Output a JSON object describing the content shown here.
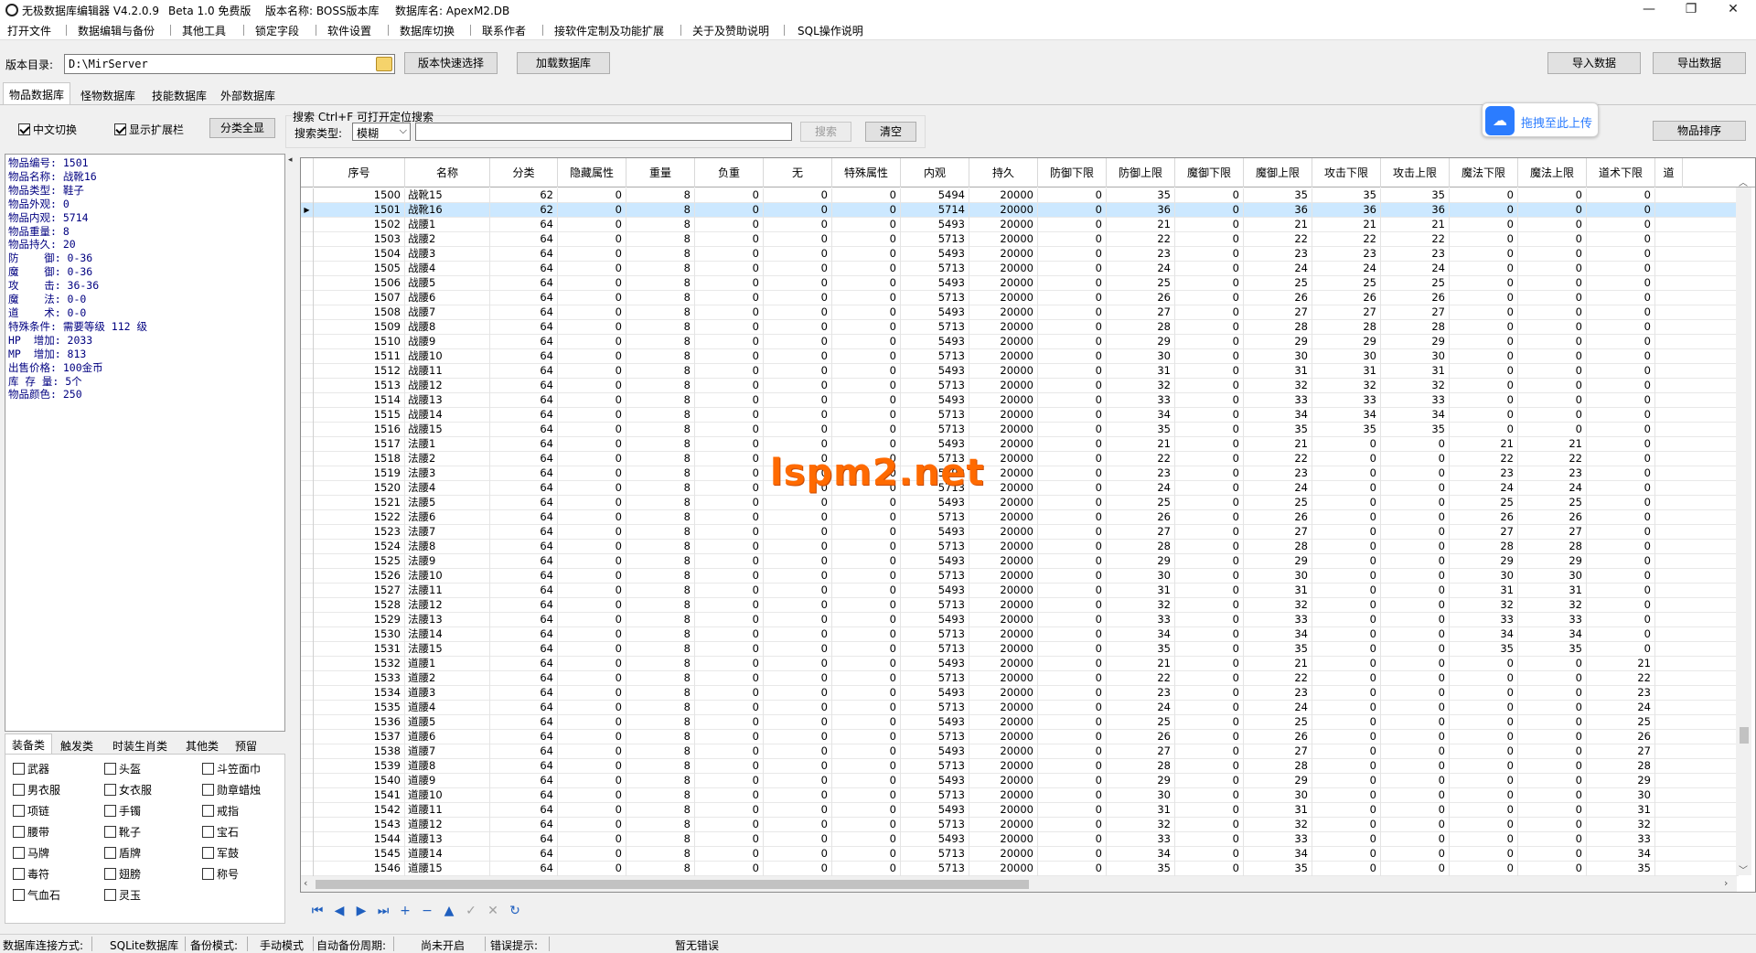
{
  "window": {
    "title": "无极数据库编辑器 V4.2.0.9",
    "beta": "Beta 1.0 免费版",
    "version_label": "版本名称: BOSS版本库",
    "db_label": "数据库名: ApexM2.DB",
    "minimize": "—",
    "maximize": "❐",
    "close": "✕"
  },
  "menu": [
    "打开文件",
    "数据编辑与备份",
    "其他工具",
    "锁定字段",
    "软件设置",
    "数据库切换",
    "联系作者",
    "接软件定制及功能扩展",
    "关于及赞助说明",
    "SQL操作说明"
  ],
  "toolbar": {
    "dir_label": "版本目录:",
    "dir_value": "D:\\MirServer",
    "quick_select": "版本快速选择",
    "load_db": "加载数据库",
    "import": "导入数据",
    "export": "导出数据"
  },
  "tabs": [
    "物品数据库",
    "怪物数据库",
    "技能数据库",
    "外部数据库"
  ],
  "options": {
    "chinese_switch": "中文切换",
    "show_ext": "显示扩展栏",
    "show_all": "分类全显",
    "search_hint": "搜索  Ctrl+F 可打开定位搜索",
    "search_type_label": "搜索类型:",
    "search_type_value": "模糊",
    "search_btn": "搜索",
    "clear_btn": "清空",
    "upload": "拖拽至此上传",
    "sort": "物品排序"
  },
  "info": [
    "物品编号: 1501",
    "物品名称: 战靴16",
    "物品类型: 鞋子",
    "物品外观: 0",
    "物品内观: 5714",
    "物品重量: 8",
    "物品持久: 20",
    "防    御: 0-36",
    "魔    御: 0-36",
    "攻    击: 36-36",
    "魔    法: 0-0",
    "道    术: 0-0",
    "特殊条件: 需要等级 112 级",
    "HP  增加: 2033",
    "MP  增加: 813",
    "出售价格: 100金币",
    "库 存 量: 5个",
    "物品颜色: 250"
  ],
  "cat_tabs": [
    "装备类",
    "触发类",
    "时装生肖类",
    "其他类",
    "预留"
  ],
  "categories": [
    {
      "label": "武器",
      "checked": false
    },
    {
      "label": "头盔",
      "checked": false
    },
    {
      "label": "斗笠面巾",
      "checked": false
    },
    {
      "label": "男衣服",
      "checked": false
    },
    {
      "label": "女衣服",
      "checked": false
    },
    {
      "label": "勋章蜡烛",
      "checked": false
    },
    {
      "label": "项链",
      "checked": false
    },
    {
      "label": "手镯",
      "checked": false
    },
    {
      "label": "戒指",
      "checked": false
    },
    {
      "label": "腰带",
      "checked": false
    },
    {
      "label": "靴子",
      "checked": false
    },
    {
      "label": "宝石",
      "checked": false
    },
    {
      "label": "马牌",
      "checked": false
    },
    {
      "label": "盾牌",
      "checked": false
    },
    {
      "label": "军鼓",
      "checked": false
    },
    {
      "label": "毒符",
      "checked": false
    },
    {
      "label": "翅膀",
      "checked": false
    },
    {
      "label": "称号",
      "checked": false
    },
    {
      "label": "气血石",
      "checked": false
    },
    {
      "label": "灵玉",
      "checked": false
    }
  ],
  "grid": {
    "columns": [
      "序号",
      "名称",
      "分类",
      "隐藏属性",
      "重量",
      "负重",
      "无",
      "特殊属性",
      "内观",
      "持久",
      "防御下限",
      "防御上限",
      "魔御下限",
      "魔御上限",
      "攻击下限",
      "攻击上限",
      "魔法下限",
      "魔法上限",
      "道术下限",
      "道"
    ],
    "selected_index": 1,
    "rows": [
      [
        "1500",
        "战靴15",
        "62",
        "0",
        "8",
        "0",
        "0",
        "0",
        "5494",
        "20000",
        "0",
        "35",
        "0",
        "35",
        "35",
        "35",
        "0",
        "0",
        "0"
      ],
      [
        "1501",
        "战靴16",
        "62",
        "0",
        "8",
        "0",
        "0",
        "0",
        "5714",
        "20000",
        "0",
        "36",
        "0",
        "36",
        "36",
        "36",
        "0",
        "0",
        "0"
      ],
      [
        "1502",
        "战腰1",
        "64",
        "0",
        "8",
        "0",
        "0",
        "0",
        "5493",
        "20000",
        "0",
        "21",
        "0",
        "21",
        "21",
        "21",
        "0",
        "0",
        "0"
      ],
      [
        "1503",
        "战腰2",
        "64",
        "0",
        "8",
        "0",
        "0",
        "0",
        "5713",
        "20000",
        "0",
        "22",
        "0",
        "22",
        "22",
        "22",
        "0",
        "0",
        "0"
      ],
      [
        "1504",
        "战腰3",
        "64",
        "0",
        "8",
        "0",
        "0",
        "0",
        "5493",
        "20000",
        "0",
        "23",
        "0",
        "23",
        "23",
        "23",
        "0",
        "0",
        "0"
      ],
      [
        "1505",
        "战腰4",
        "64",
        "0",
        "8",
        "0",
        "0",
        "0",
        "5713",
        "20000",
        "0",
        "24",
        "0",
        "24",
        "24",
        "24",
        "0",
        "0",
        "0"
      ],
      [
        "1506",
        "战腰5",
        "64",
        "0",
        "8",
        "0",
        "0",
        "0",
        "5493",
        "20000",
        "0",
        "25",
        "0",
        "25",
        "25",
        "25",
        "0",
        "0",
        "0"
      ],
      [
        "1507",
        "战腰6",
        "64",
        "0",
        "8",
        "0",
        "0",
        "0",
        "5713",
        "20000",
        "0",
        "26",
        "0",
        "26",
        "26",
        "26",
        "0",
        "0",
        "0"
      ],
      [
        "1508",
        "战腰7",
        "64",
        "0",
        "8",
        "0",
        "0",
        "0",
        "5493",
        "20000",
        "0",
        "27",
        "0",
        "27",
        "27",
        "27",
        "0",
        "0",
        "0"
      ],
      [
        "1509",
        "战腰8",
        "64",
        "0",
        "8",
        "0",
        "0",
        "0",
        "5713",
        "20000",
        "0",
        "28",
        "0",
        "28",
        "28",
        "28",
        "0",
        "0",
        "0"
      ],
      [
        "1510",
        "战腰9",
        "64",
        "0",
        "8",
        "0",
        "0",
        "0",
        "5493",
        "20000",
        "0",
        "29",
        "0",
        "29",
        "29",
        "29",
        "0",
        "0",
        "0"
      ],
      [
        "1511",
        "战腰10",
        "64",
        "0",
        "8",
        "0",
        "0",
        "0",
        "5713",
        "20000",
        "0",
        "30",
        "0",
        "30",
        "30",
        "30",
        "0",
        "0",
        "0"
      ],
      [
        "1512",
        "战腰11",
        "64",
        "0",
        "8",
        "0",
        "0",
        "0",
        "5493",
        "20000",
        "0",
        "31",
        "0",
        "31",
        "31",
        "31",
        "0",
        "0",
        "0"
      ],
      [
        "1513",
        "战腰12",
        "64",
        "0",
        "8",
        "0",
        "0",
        "0",
        "5713",
        "20000",
        "0",
        "32",
        "0",
        "32",
        "32",
        "32",
        "0",
        "0",
        "0"
      ],
      [
        "1514",
        "战腰13",
        "64",
        "0",
        "8",
        "0",
        "0",
        "0",
        "5493",
        "20000",
        "0",
        "33",
        "0",
        "33",
        "33",
        "33",
        "0",
        "0",
        "0"
      ],
      [
        "1515",
        "战腰14",
        "64",
        "0",
        "8",
        "0",
        "0",
        "0",
        "5713",
        "20000",
        "0",
        "34",
        "0",
        "34",
        "34",
        "34",
        "0",
        "0",
        "0"
      ],
      [
        "1516",
        "战腰15",
        "64",
        "0",
        "8",
        "0",
        "0",
        "0",
        "5713",
        "20000",
        "0",
        "35",
        "0",
        "35",
        "35",
        "35",
        "0",
        "0",
        "0"
      ],
      [
        "1517",
        "法腰1",
        "64",
        "0",
        "8",
        "0",
        "0",
        "0",
        "5493",
        "20000",
        "0",
        "21",
        "0",
        "21",
        "0",
        "0",
        "21",
        "21",
        "0"
      ],
      [
        "1518",
        "法腰2",
        "64",
        "0",
        "8",
        "0",
        "0",
        "0",
        "5713",
        "20000",
        "0",
        "22",
        "0",
        "22",
        "0",
        "0",
        "22",
        "22",
        "0"
      ],
      [
        "1519",
        "法腰3",
        "64",
        "0",
        "8",
        "0",
        "0",
        "0",
        "5493",
        "20000",
        "0",
        "23",
        "0",
        "23",
        "0",
        "0",
        "23",
        "23",
        "0"
      ],
      [
        "1520",
        "法腰4",
        "64",
        "0",
        "8",
        "0",
        "0",
        "0",
        "5713",
        "20000",
        "0",
        "24",
        "0",
        "24",
        "0",
        "0",
        "24",
        "24",
        "0"
      ],
      [
        "1521",
        "法腰5",
        "64",
        "0",
        "8",
        "0",
        "0",
        "0",
        "5493",
        "20000",
        "0",
        "25",
        "0",
        "25",
        "0",
        "0",
        "25",
        "25",
        "0"
      ],
      [
        "1522",
        "法腰6",
        "64",
        "0",
        "8",
        "0",
        "0",
        "0",
        "5713",
        "20000",
        "0",
        "26",
        "0",
        "26",
        "0",
        "0",
        "26",
        "26",
        "0"
      ],
      [
        "1523",
        "法腰7",
        "64",
        "0",
        "8",
        "0",
        "0",
        "0",
        "5493",
        "20000",
        "0",
        "27",
        "0",
        "27",
        "0",
        "0",
        "27",
        "27",
        "0"
      ],
      [
        "1524",
        "法腰8",
        "64",
        "0",
        "8",
        "0",
        "0",
        "0",
        "5713",
        "20000",
        "0",
        "28",
        "0",
        "28",
        "0",
        "0",
        "28",
        "28",
        "0"
      ],
      [
        "1525",
        "法腰9",
        "64",
        "0",
        "8",
        "0",
        "0",
        "0",
        "5493",
        "20000",
        "0",
        "29",
        "0",
        "29",
        "0",
        "0",
        "29",
        "29",
        "0"
      ],
      [
        "1526",
        "法腰10",
        "64",
        "0",
        "8",
        "0",
        "0",
        "0",
        "5713",
        "20000",
        "0",
        "30",
        "0",
        "30",
        "0",
        "0",
        "30",
        "30",
        "0"
      ],
      [
        "1527",
        "法腰11",
        "64",
        "0",
        "8",
        "0",
        "0",
        "0",
        "5493",
        "20000",
        "0",
        "31",
        "0",
        "31",
        "0",
        "0",
        "31",
        "31",
        "0"
      ],
      [
        "1528",
        "法腰12",
        "64",
        "0",
        "8",
        "0",
        "0",
        "0",
        "5713",
        "20000",
        "0",
        "32",
        "0",
        "32",
        "0",
        "0",
        "32",
        "32",
        "0"
      ],
      [
        "1529",
        "法腰13",
        "64",
        "0",
        "8",
        "0",
        "0",
        "0",
        "5493",
        "20000",
        "0",
        "33",
        "0",
        "33",
        "0",
        "0",
        "33",
        "33",
        "0"
      ],
      [
        "1530",
        "法腰14",
        "64",
        "0",
        "8",
        "0",
        "0",
        "0",
        "5713",
        "20000",
        "0",
        "34",
        "0",
        "34",
        "0",
        "0",
        "34",
        "34",
        "0"
      ],
      [
        "1531",
        "法腰15",
        "64",
        "0",
        "8",
        "0",
        "0",
        "0",
        "5713",
        "20000",
        "0",
        "35",
        "0",
        "35",
        "0",
        "0",
        "35",
        "35",
        "0"
      ],
      [
        "1532",
        "道腰1",
        "64",
        "0",
        "8",
        "0",
        "0",
        "0",
        "5493",
        "20000",
        "0",
        "21",
        "0",
        "21",
        "0",
        "0",
        "0",
        "0",
        "21"
      ],
      [
        "1533",
        "道腰2",
        "64",
        "0",
        "8",
        "0",
        "0",
        "0",
        "5713",
        "20000",
        "0",
        "22",
        "0",
        "22",
        "0",
        "0",
        "0",
        "0",
        "22"
      ],
      [
        "1534",
        "道腰3",
        "64",
        "0",
        "8",
        "0",
        "0",
        "0",
        "5493",
        "20000",
        "0",
        "23",
        "0",
        "23",
        "0",
        "0",
        "0",
        "0",
        "23"
      ],
      [
        "1535",
        "道腰4",
        "64",
        "0",
        "8",
        "0",
        "0",
        "0",
        "5713",
        "20000",
        "0",
        "24",
        "0",
        "24",
        "0",
        "0",
        "0",
        "0",
        "24"
      ],
      [
        "1536",
        "道腰5",
        "64",
        "0",
        "8",
        "0",
        "0",
        "0",
        "5493",
        "20000",
        "0",
        "25",
        "0",
        "25",
        "0",
        "0",
        "0",
        "0",
        "25"
      ],
      [
        "1537",
        "道腰6",
        "64",
        "0",
        "8",
        "0",
        "0",
        "0",
        "5713",
        "20000",
        "0",
        "26",
        "0",
        "26",
        "0",
        "0",
        "0",
        "0",
        "26"
      ],
      [
        "1538",
        "道腰7",
        "64",
        "0",
        "8",
        "0",
        "0",
        "0",
        "5493",
        "20000",
        "0",
        "27",
        "0",
        "27",
        "0",
        "0",
        "0",
        "0",
        "27"
      ],
      [
        "1539",
        "道腰8",
        "64",
        "0",
        "8",
        "0",
        "0",
        "0",
        "5713",
        "20000",
        "0",
        "28",
        "0",
        "28",
        "0",
        "0",
        "0",
        "0",
        "28"
      ],
      [
        "1540",
        "道腰9",
        "64",
        "0",
        "8",
        "0",
        "0",
        "0",
        "5493",
        "20000",
        "0",
        "29",
        "0",
        "29",
        "0",
        "0",
        "0",
        "0",
        "29"
      ],
      [
        "1541",
        "道腰10",
        "64",
        "0",
        "8",
        "0",
        "0",
        "0",
        "5713",
        "20000",
        "0",
        "30",
        "0",
        "30",
        "0",
        "0",
        "0",
        "0",
        "30"
      ],
      [
        "1542",
        "道腰11",
        "64",
        "0",
        "8",
        "0",
        "0",
        "0",
        "5493",
        "20000",
        "0",
        "31",
        "0",
        "31",
        "0",
        "0",
        "0",
        "0",
        "31"
      ],
      [
        "1543",
        "道腰12",
        "64",
        "0",
        "8",
        "0",
        "0",
        "0",
        "5713",
        "20000",
        "0",
        "32",
        "0",
        "32",
        "0",
        "0",
        "0",
        "0",
        "32"
      ],
      [
        "1544",
        "道腰13",
        "64",
        "0",
        "8",
        "0",
        "0",
        "0",
        "5493",
        "20000",
        "0",
        "33",
        "0",
        "33",
        "0",
        "0",
        "0",
        "0",
        "33"
      ],
      [
        "1545",
        "道腰14",
        "64",
        "0",
        "8",
        "0",
        "0",
        "0",
        "5713",
        "20000",
        "0",
        "34",
        "0",
        "34",
        "0",
        "0",
        "0",
        "0",
        "34"
      ],
      [
        "1546",
        "道腰15",
        "64",
        "0",
        "8",
        "0",
        "0",
        "0",
        "5713",
        "20000",
        "0",
        "35",
        "0",
        "35",
        "0",
        "0",
        "0",
        "0",
        "35"
      ]
    ]
  },
  "navigator": [
    {
      "name": "nav-first-icon",
      "glyph": "⏮",
      "enabled": true
    },
    {
      "name": "nav-prior-icon",
      "glyph": "◀",
      "enabled": true
    },
    {
      "name": "nav-next-icon",
      "glyph": "▶",
      "enabled": true
    },
    {
      "name": "nav-last-icon",
      "glyph": "⏭",
      "enabled": true
    },
    {
      "name": "nav-insert-icon",
      "glyph": "+",
      "enabled": true
    },
    {
      "name": "nav-delete-icon",
      "glyph": "−",
      "enabled": true
    },
    {
      "name": "nav-edit-icon",
      "glyph": "▲",
      "enabled": true
    },
    {
      "name": "nav-post-icon",
      "glyph": "✓",
      "enabled": false
    },
    {
      "name": "nav-cancel-icon",
      "glyph": "✕",
      "enabled": false
    },
    {
      "name": "nav-refresh-icon",
      "glyph": "↻",
      "enabled": true
    }
  ],
  "status": {
    "conn_label": "数据库连接方式:",
    "conn_value": "SQLite数据库",
    "backup_label": "备份模式:",
    "backup_value": "手动模式",
    "auto_label": "自动备份周期:",
    "auto_value": "尚未开启",
    "error_label": "错误提示:",
    "error_value": "暂无错误"
  },
  "watermark": "lspm2.net"
}
